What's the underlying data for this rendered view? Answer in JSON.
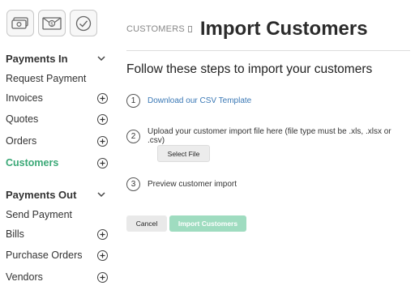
{
  "top_icons": [
    "cash-icon",
    "envelope-dollar-icon",
    "checkmark-circle-icon"
  ],
  "sidebar": {
    "payments_in": {
      "title": "Payments In",
      "items": [
        {
          "label": "Request Payment",
          "has_add": false
        },
        {
          "label": "Invoices",
          "has_add": true
        },
        {
          "label": "Quotes",
          "has_add": true
        },
        {
          "label": "Orders",
          "has_add": true
        },
        {
          "label": "Customers",
          "has_add": true,
          "active": true
        }
      ]
    },
    "payments_out": {
      "title": "Payments Out",
      "items": [
        {
          "label": "Send Payment",
          "has_add": false
        },
        {
          "label": "Bills",
          "has_add": true
        },
        {
          "label": "Purchase Orders",
          "has_add": true
        },
        {
          "label": "Vendors",
          "has_add": true
        }
      ]
    }
  },
  "header": {
    "breadcrumb": "CUSTOMERS",
    "title": "Import Customers"
  },
  "main": {
    "subtitle": "Follow these steps to import your customers",
    "steps": [
      {
        "num": "1",
        "text": "Download our CSV Template"
      },
      {
        "num": "2",
        "text": "Upload your customer import file here (file type must be .xls, .xlsx or .csv)"
      },
      {
        "num": "3",
        "text": "Preview customer import"
      }
    ],
    "select_file_label": "Select File",
    "cancel_label": "Cancel",
    "import_label": "Import Customers"
  },
  "colors": {
    "active": "#3aa876",
    "link": "#3a78b5",
    "import_button": "#9fdcc0"
  }
}
